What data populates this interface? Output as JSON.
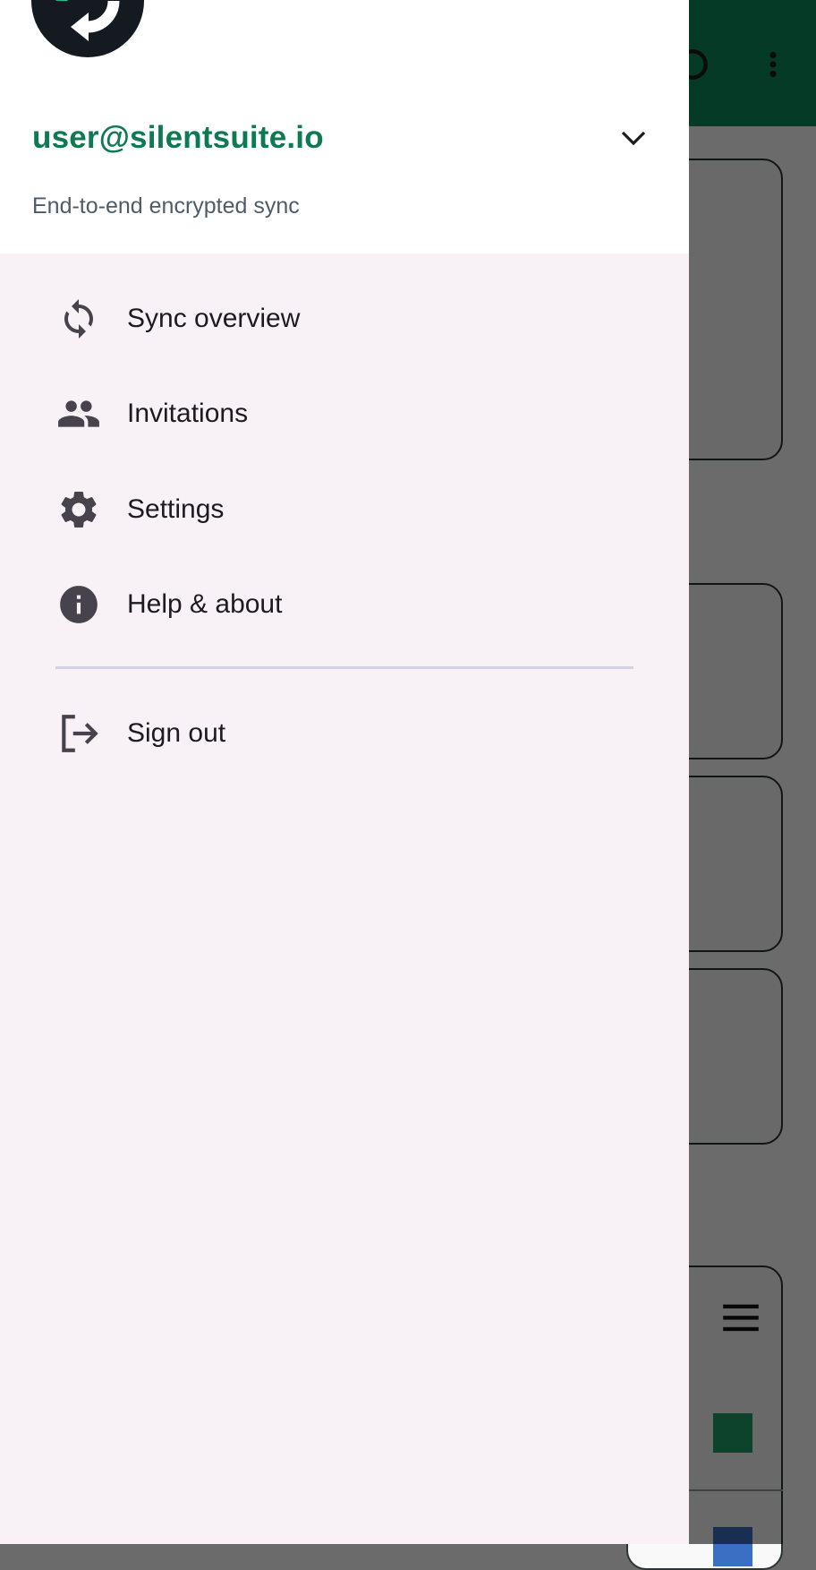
{
  "drawer": {
    "account_email": "user@silentsuite.io",
    "account_subtitle": "End-to-end encrypted sync",
    "items": [
      {
        "label": "Sync overview",
        "icon": "sync-icon"
      },
      {
        "label": "Invitations",
        "icon": "people-icon"
      },
      {
        "label": "Settings",
        "icon": "gear-icon"
      },
      {
        "label": "Help & about",
        "icon": "info-icon"
      }
    ],
    "signout": {
      "label": "Sign out",
      "icon": "logout-icon"
    }
  },
  "colors": {
    "brand_green": "#0e7a52",
    "toolbar_green": "#0c8a5c",
    "drawer_background": "#f8f2f7"
  }
}
